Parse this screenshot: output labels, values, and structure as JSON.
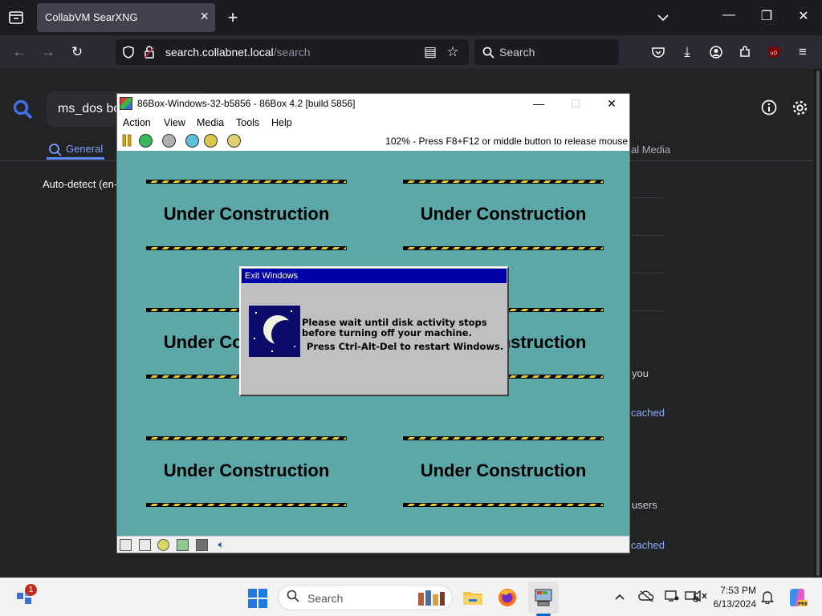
{
  "browser": {
    "tab_title": "CollabVM SearXNG",
    "url_host": "search.collabnet.local",
    "url_path": "/search",
    "search_placeholder": "Search"
  },
  "page": {
    "query": "ms_dos bo",
    "tab_general": "General",
    "language": "Auto-detect (en-",
    "social_media_tab": "al Media",
    "side_text_1": "you",
    "side_link_1": "cached",
    "side_text_2": "users",
    "side_link_2": "cached"
  },
  "vm_window": {
    "title": "86Box-Windows-32-b5856 - 86Box 4.2 [build 5856]",
    "menu": [
      "Action",
      "View",
      "Media",
      "Tools",
      "Help"
    ],
    "status_message": "102% - Press F8+F12 or middle button to release mouse",
    "construction_text": "Under Construction",
    "dialog": {
      "title": "Exit Windows",
      "line1": "Please wait until disk activity stops before turning off your machine.",
      "line2": "Press Ctrl-Alt-Del to restart Windows."
    }
  },
  "taskbar": {
    "search_label": "Search",
    "widgets_badge": "1",
    "time": "7:53 PM",
    "date": "6/13/2024"
  },
  "colors": {
    "vm_desktop": "#5ca8a8",
    "dialog_title": "#0000a8",
    "accent_link": "#7aa0ff"
  }
}
